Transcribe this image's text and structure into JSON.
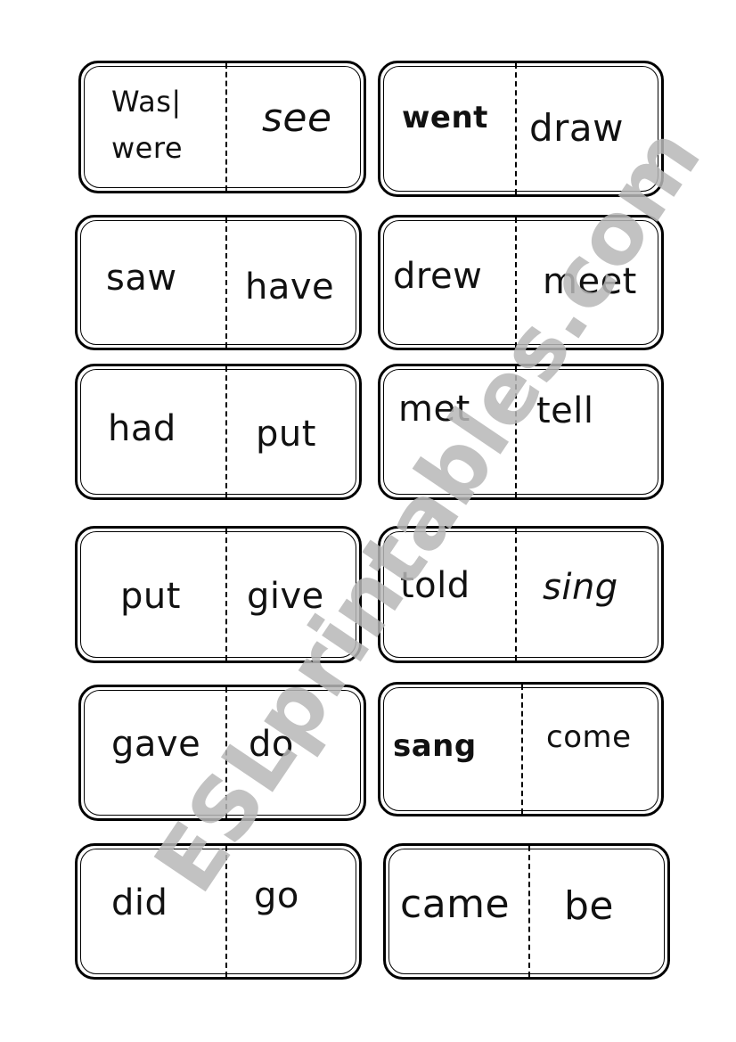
{
  "worksheet": {
    "type": "domino cards",
    "watermark": "ESLprintables.com",
    "cards": [
      {
        "left": "Was| were",
        "left_lines": [
          "Was|",
          "were"
        ],
        "right": "see"
      },
      {
        "left": "went",
        "right": "draw"
      },
      {
        "left": "saw",
        "right": "have"
      },
      {
        "left": "drew",
        "right": "meet"
      },
      {
        "left": "had",
        "right": "put"
      },
      {
        "left": "met",
        "right": "tell"
      },
      {
        "left": "put",
        "right": "give"
      },
      {
        "left": "told",
        "right": "sing"
      },
      {
        "left": "gave",
        "right": "do"
      },
      {
        "left": "sang",
        "right": "come"
      },
      {
        "left": "did",
        "right": "go"
      },
      {
        "left": "came",
        "right": "be"
      }
    ]
  }
}
